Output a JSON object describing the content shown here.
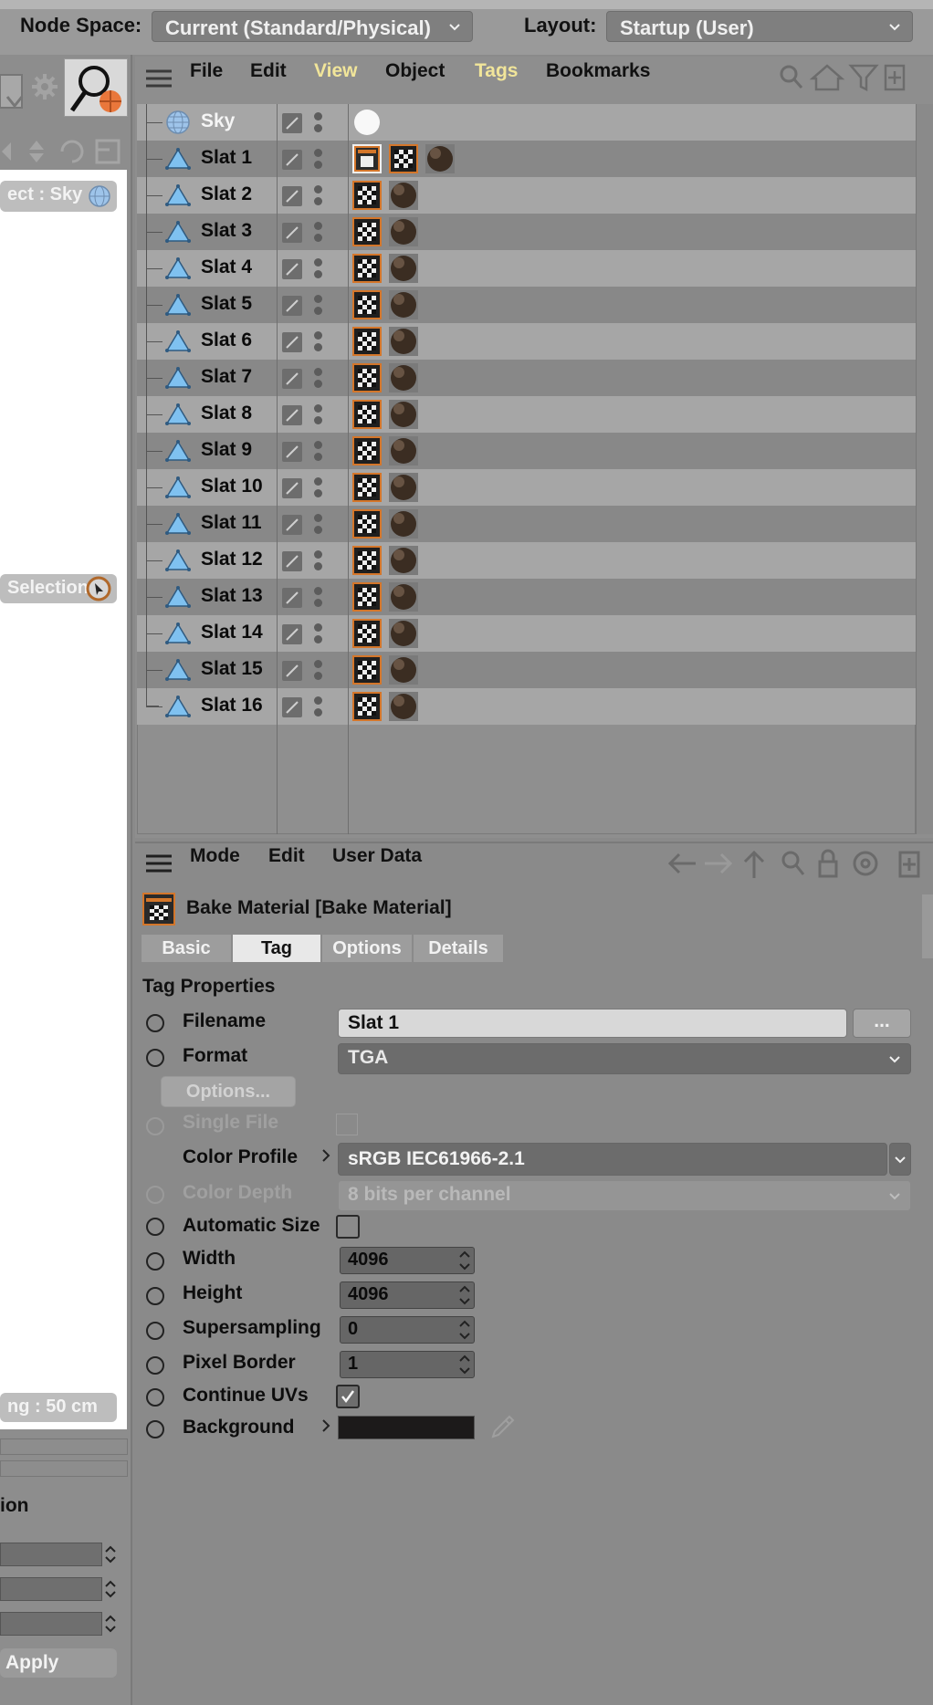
{
  "topbar": {
    "node_space_label": "Node Space:",
    "node_space_value": "Current (Standard/Physical)",
    "layout_label": "Layout:",
    "layout_value": "Startup (User)"
  },
  "left": {
    "object_pill": "ect : Sky",
    "selection_pill": "Selection",
    "spacing_pill": "ng : 50 cm",
    "section_label": "ion",
    "apply_label": "Apply"
  },
  "om": {
    "menu": [
      "File",
      "Edit",
      "View",
      "Object",
      "Tags",
      "Bookmarks"
    ],
    "rows": [
      {
        "name": "Sky"
      },
      {
        "name": "Slat 1"
      },
      {
        "name": "Slat 2"
      },
      {
        "name": "Slat 3"
      },
      {
        "name": "Slat 4"
      },
      {
        "name": "Slat 5"
      },
      {
        "name": "Slat 6"
      },
      {
        "name": "Slat 7"
      },
      {
        "name": "Slat 8"
      },
      {
        "name": "Slat 9"
      },
      {
        "name": "Slat 10"
      },
      {
        "name": "Slat 11"
      },
      {
        "name": "Slat 12"
      },
      {
        "name": "Slat 13"
      },
      {
        "name": "Slat 14"
      },
      {
        "name": "Slat 15"
      },
      {
        "name": "Slat 16"
      }
    ]
  },
  "am": {
    "menu": [
      "Mode",
      "Edit",
      "User Data"
    ],
    "title": "Bake Material [Bake Material]",
    "tabs": [
      "Basic",
      "Tag",
      "Options",
      "Details"
    ],
    "active_tab": "Tag",
    "section": "Tag Properties",
    "filename_label": "Filename",
    "filename_value": "Slat 1",
    "browse_label": "...",
    "format_label": "Format",
    "format_value": "TGA",
    "options_button": "Options...",
    "single_file_label": "Single File",
    "color_profile_label": "Color Profile",
    "color_profile_value": "sRGB IEC61966-2.1",
    "color_depth_label": "Color Depth",
    "color_depth_value": "8 bits per channel",
    "automatic_size_label": "Automatic Size",
    "width_label": "Width",
    "width_value": "4096",
    "height_label": "Height",
    "height_value": "4096",
    "supersampling_label": "Supersampling",
    "supersampling_value": "0",
    "pixel_border_label": "Pixel Border",
    "pixel_border_value": "1",
    "continue_uvs_label": "Continue UVs",
    "background_label": "Background"
  },
  "colors": {
    "menu_highlight": "#f1e59a",
    "background_swatch": "#1c1a1a",
    "polygon_icon": "#7fc1f0",
    "bake_tag_orange": "#d4762a"
  }
}
